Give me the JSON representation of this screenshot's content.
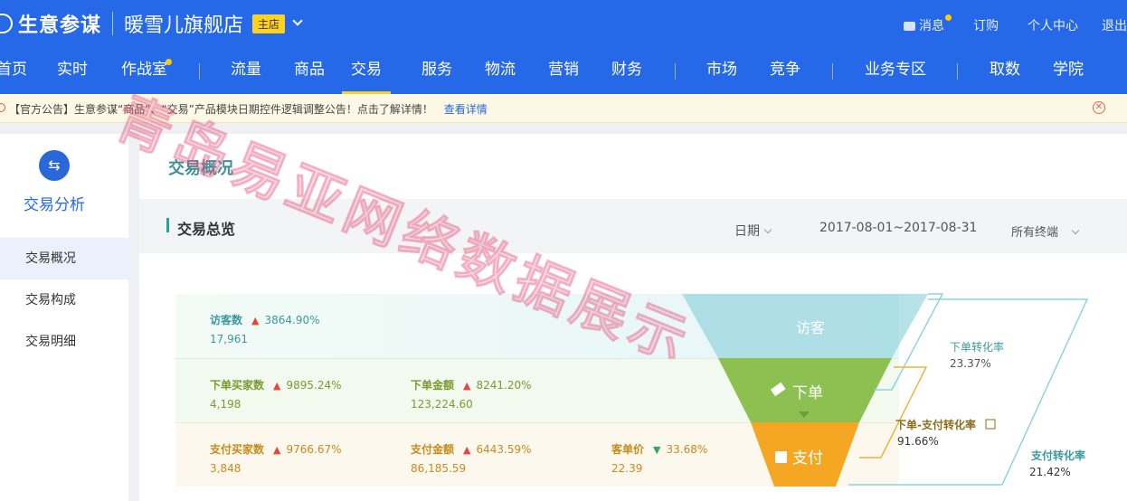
{
  "header": {
    "brand": "生意参谋",
    "shop": "暖雪儿旗舰店",
    "shop_badge": "主店",
    "links": [
      "消息",
      "订购",
      "个人中心",
      "退出"
    ]
  },
  "nav": {
    "items": [
      "首页",
      "实时",
      "作战室",
      "流量",
      "商品",
      "交易",
      "服务",
      "物流",
      "营销",
      "财务",
      "市场",
      "竞争",
      "业务专区",
      "取数",
      "学院"
    ],
    "active": "交易"
  },
  "notice": {
    "text": "【官方公告】生意参谋“商品”、“交易”产品模块日期控件逻辑调整公告！点击了解详情！",
    "link": "查看详情"
  },
  "sidebar": {
    "title": "交易分析",
    "items": [
      "交易概况",
      "交易构成",
      "交易明细"
    ],
    "active": "交易概况"
  },
  "main": {
    "page_title": "交易概况",
    "section_title": "交易总览",
    "date_label": "日期",
    "date_range": "2017-08-01~2017-08-31",
    "terminal": "所有终端"
  },
  "metrics": {
    "visitors": {
      "label": "访客数",
      "change": "3864.90%",
      "value": "17,961",
      "trend": "up"
    },
    "order_buyers": {
      "label": "下单买家数",
      "change": "9895.24%",
      "value": "4,198",
      "trend": "up"
    },
    "order_amount": {
      "label": "下单金额",
      "change": "8241.20%",
      "value": "123,224.60",
      "trend": "up"
    },
    "pay_buyers": {
      "label": "支付买家数",
      "change": "9766.67%",
      "value": "3,848",
      "trend": "up"
    },
    "pay_amount": {
      "label": "支付金额",
      "change": "6443.59%",
      "value": "86,185.59",
      "trend": "up"
    },
    "unit_price": {
      "label": "客单价",
      "change": "33.68%",
      "value": "22.39",
      "trend": "down"
    }
  },
  "funnel": {
    "stages": [
      "访客",
      "下单",
      "支付"
    ],
    "rates": [
      {
        "label": "下单转化率",
        "value": "23.37%"
      },
      {
        "label": "下单-支付转化率",
        "value": "91.66%"
      },
      {
        "label": "支付转化率",
        "value": "21.42%"
      }
    ]
  },
  "watermark": "青岛易亚网络数据展示",
  "colors": {
    "primary": "#2568e8",
    "teal": "#3b9aa0",
    "green": "#8cc152",
    "orange": "#f5a623"
  }
}
